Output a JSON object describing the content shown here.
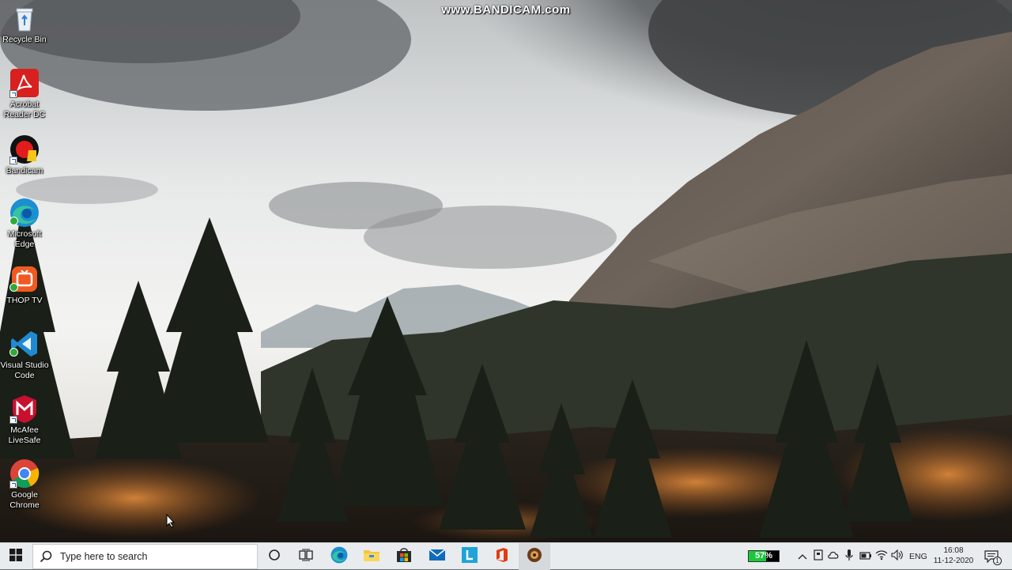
{
  "watermark": {
    "text": "www.BANDICAM.com"
  },
  "desktop": {
    "icons": [
      {
        "label": "Recycle Bin",
        "icon": "recycle-bin-icon"
      },
      {
        "label": "Acrobat Reader DC",
        "icon": "acrobat-reader-icon"
      },
      {
        "label": "Bandicam",
        "icon": "bandicam-icon"
      },
      {
        "label": "Microsoft Edge",
        "icon": "edge-icon"
      },
      {
        "label": "THOP TV",
        "icon": "thop-tv-icon"
      },
      {
        "label": "Visual Studio Code",
        "icon": "vscode-icon"
      },
      {
        "label": "McAfee LiveSafe",
        "icon": "mcafee-icon"
      },
      {
        "label": "Google Chrome",
        "icon": "chrome-icon"
      }
    ]
  },
  "taskbar": {
    "search_placeholder": "Type here to search",
    "pinned": [
      "cortana-icon",
      "task-view-icon",
      "edge-icon",
      "file-explorer-icon",
      "microsoft-store-icon",
      "mail-icon",
      "l-app-icon",
      "office-icon",
      "bandicam-icon"
    ],
    "tray": {
      "battery_percent": 57,
      "battery_label": "57%",
      "language": "ENG",
      "time": "16:08",
      "date": "11-12-2020",
      "notification_count": "1"
    }
  },
  "colors": {
    "taskbar_bg": "#e9ecee",
    "battery_fill": "#19c93a",
    "accent": "#0078d4"
  }
}
